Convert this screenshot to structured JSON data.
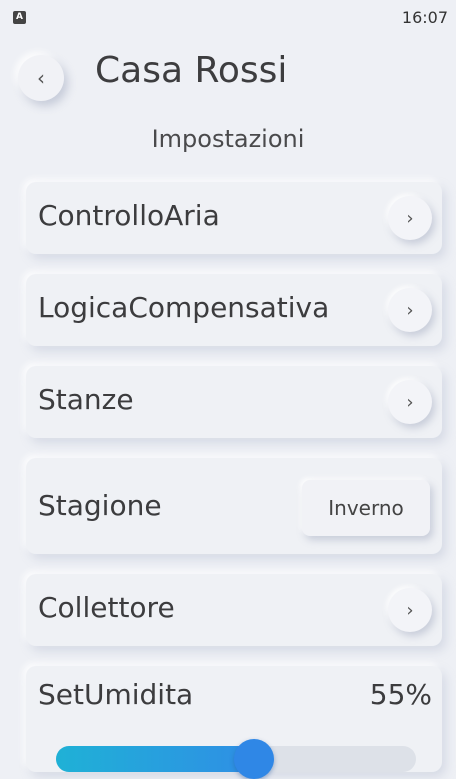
{
  "status_bar": {
    "notification_icon": "A",
    "time": "16:07"
  },
  "header": {
    "back_icon": "‹",
    "title": "Casa Rossi"
  },
  "subtitle": "Impostazioni",
  "menu": {
    "controllo_aria": {
      "label": "ControlloAria",
      "chevron": "›"
    },
    "logica_compensativa": {
      "label": "LogicaCompensativa",
      "chevron": "›"
    },
    "stanze": {
      "label": "Stanze",
      "chevron": "›"
    },
    "stagione": {
      "label": "Stagione",
      "value": "Inverno"
    },
    "collettore": {
      "label": "Collettore",
      "chevron": "›"
    },
    "set_umidita": {
      "label": "SetUmidita",
      "value": "55%",
      "level_fraction": 0.55
    }
  },
  "colors": {
    "background": "#eef0f5",
    "accent": "#2f87e6",
    "accent_start": "#1fb1d6"
  }
}
